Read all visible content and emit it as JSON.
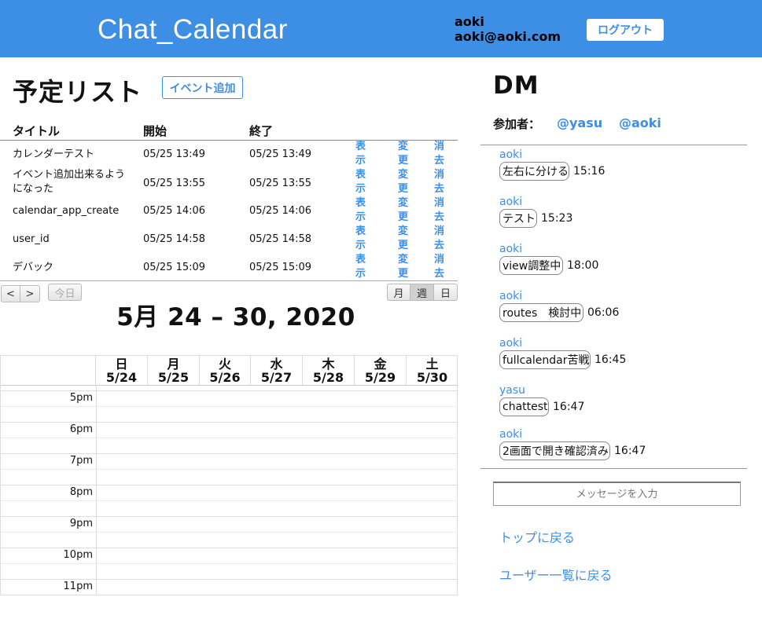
{
  "header": {
    "app_title": "Chat_Calendar",
    "user_name": "aoki",
    "user_email": "aoki@aoki.com",
    "logout_label": "ログアウト"
  },
  "schedule": {
    "title": "予定リスト",
    "add_event_label": "イベント追加",
    "columns": [
      "タイトル",
      "開始",
      "終了"
    ],
    "actions": [
      "表示",
      "変更",
      "消去"
    ],
    "rows": [
      {
        "title": "カレンダーテスト",
        "start": "05/25 13:49",
        "end": "05/25 13:49"
      },
      {
        "title": "イベント追加出来るようになった",
        "start": "05/25 13:55",
        "end": "05/25 13:55"
      },
      {
        "title": "calendar_app_create",
        "start": "05/25 14:06",
        "end": "05/25 14:06"
      },
      {
        "title": "user_id",
        "start": "05/25 14:58",
        "end": "05/25 14:58"
      },
      {
        "title": "デバック",
        "start": "05/25 15:09",
        "end": "05/25 15:09"
      }
    ]
  },
  "calendar": {
    "prev_label": "<",
    "next_label": ">",
    "today_label": "今日",
    "view_month": "月",
    "view_week": "週",
    "view_day": "日",
    "active_view": "週",
    "title": "5月 24 – 30, 2020",
    "days": [
      {
        "weekday": "日",
        "date": "5/24"
      },
      {
        "weekday": "月",
        "date": "5/25"
      },
      {
        "weekday": "火",
        "date": "5/26"
      },
      {
        "weekday": "水",
        "date": "5/27"
      },
      {
        "weekday": "木",
        "date": "5/28"
      },
      {
        "weekday": "金",
        "date": "5/29"
      },
      {
        "weekday": "土",
        "date": "5/30"
      }
    ],
    "times": [
      "5pm",
      "6pm",
      "7pm",
      "8pm",
      "9pm",
      "10pm",
      "11pm"
    ]
  },
  "dm": {
    "title": "DM",
    "participants_label": "参加者：",
    "participants": [
      "@yasu",
      "@aoki"
    ],
    "messages": [
      {
        "user": "aoki",
        "text": "左右に分ける",
        "time": "15:16"
      },
      {
        "user": "aoki",
        "text": "テスト",
        "time": "15:23"
      },
      {
        "user": "aoki",
        "text": "view調整中",
        "time": "18:00"
      },
      {
        "user": "aoki",
        "text": "routes　検討中",
        "time": "06:06"
      },
      {
        "user": "aoki",
        "text": "fullcalendar苦戦",
        "time": "16:45"
      },
      {
        "user": "yasu",
        "text": "chattest",
        "time": "16:47"
      },
      {
        "user": "aoki",
        "text": "2画面で開き確認済み",
        "time": "16:47"
      }
    ],
    "input_placeholder": "メッセージを入力",
    "back_to_top": "トップに戻る",
    "back_to_users": "ユーザー一覧に戻る"
  },
  "colors": {
    "accent": "#3d8fe6",
    "header_bg": "#3d8fe6"
  }
}
